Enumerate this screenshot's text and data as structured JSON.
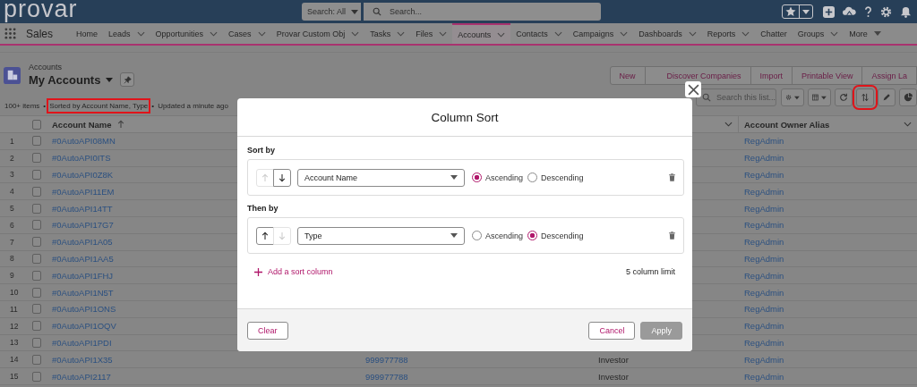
{
  "header": {
    "logo": "provar",
    "search_scope": "Search: All",
    "search": {
      "placeholder": "Search..."
    }
  },
  "nav": {
    "app": "Sales",
    "items": [
      {
        "label": "Home",
        "kind": "tab",
        "dropdown": false,
        "selected": false
      },
      {
        "label": "Leads",
        "kind": "tab",
        "dropdown": true,
        "selected": false
      },
      {
        "label": "Opportunities",
        "kind": "tab",
        "dropdown": true,
        "selected": false
      },
      {
        "label": "Cases",
        "kind": "tab",
        "dropdown": true,
        "selected": false
      },
      {
        "label": "Provar Custom Obj",
        "kind": "tab",
        "dropdown": true,
        "selected": false
      },
      {
        "label": "Tasks",
        "kind": "tab",
        "dropdown": true,
        "selected": false
      },
      {
        "label": "Files",
        "kind": "tab",
        "dropdown": true,
        "selected": false
      },
      {
        "label": "Accounts",
        "kind": "tab",
        "dropdown": true,
        "selected": true
      },
      {
        "label": "Contacts",
        "kind": "tab",
        "dropdown": true,
        "selected": false
      },
      {
        "label": "Campaigns",
        "kind": "tab",
        "dropdown": true,
        "selected": false
      },
      {
        "label": "Dashboards",
        "kind": "tab",
        "dropdown": true,
        "selected": false
      },
      {
        "label": "Reports",
        "kind": "tab",
        "dropdown": true,
        "selected": false
      },
      {
        "label": "Chatter",
        "kind": "tab",
        "dropdown": false,
        "selected": false
      },
      {
        "label": "Groups",
        "kind": "tab",
        "dropdown": true,
        "selected": false
      },
      {
        "label": "More",
        "kind": "more",
        "dropdown": true,
        "selected": false
      }
    ]
  },
  "list_header": {
    "object": "Accounts",
    "view": "My Accounts",
    "actions": [
      "New",
      "Discover Companies",
      "Import",
      "Printable View",
      "Assign La"
    ],
    "meta": [
      {
        "text": "100+ items",
        "highlighted": false
      },
      {
        "text": "•",
        "highlighted": false
      },
      {
        "text": "Sorted by Account Name, Type",
        "highlighted": true
      },
      {
        "text": "•",
        "highlighted": false
      },
      {
        "text": "Updated a minute ago",
        "highlighted": false
      }
    ],
    "search": {
      "placeholder": "Search this list..."
    },
    "tools": [
      {
        "kind": "settings",
        "dropdown": true,
        "highlighted": false
      },
      {
        "kind": "columns",
        "dropdown": true,
        "highlighted": false
      },
      {
        "kind": "refresh",
        "dropdown": false,
        "highlighted": false
      },
      {
        "kind": "sort",
        "dropdown": false,
        "highlighted": true
      },
      {
        "kind": "edit",
        "dropdown": false,
        "highlighted": false
      },
      {
        "kind": "chart",
        "dropdown": false,
        "highlighted": false
      }
    ]
  },
  "table": {
    "columns": [
      {
        "label": "Account Name",
        "sorted": true
      },
      {
        "label": "Account Owner Alias"
      }
    ],
    "all_checked": false,
    "rows": [
      {
        "number": "1",
        "checked": false,
        "name": "#0AutoAPI08MN",
        "owner": "RegAdmin"
      },
      {
        "number": "2",
        "checked": false,
        "name": "#0AutoAPI0ITS",
        "owner": "RegAdmin"
      },
      {
        "number": "3",
        "checked": false,
        "name": "#0AutoAPI0Z8K",
        "owner": "RegAdmin"
      },
      {
        "number": "4",
        "checked": false,
        "name": "#0AutoAPI11EM",
        "owner": "RegAdmin"
      },
      {
        "number": "5",
        "checked": false,
        "name": "#0AutoAPI14TT",
        "owner": "RegAdmin"
      },
      {
        "number": "6",
        "checked": false,
        "name": "#0AutoAPI17G7",
        "owner": "RegAdmin"
      },
      {
        "number": "7",
        "checked": false,
        "name": "#0AutoAPI1A05",
        "owner": "RegAdmin"
      },
      {
        "number": "8",
        "checked": false,
        "name": "#0AutoAPI1AA5",
        "owner": "RegAdmin"
      },
      {
        "number": "9",
        "checked": false,
        "name": "#0AutoAPI1FHJ",
        "owner": "RegAdmin"
      },
      {
        "number": "10",
        "checked": false,
        "name": "#0AutoAPI1N5T",
        "owner": "RegAdmin"
      },
      {
        "number": "11",
        "checked": false,
        "name": "#0AutoAPI1ONS",
        "owner": "RegAdmin"
      },
      {
        "number": "12",
        "checked": false,
        "name": "#0AutoAPI1OQV",
        "owner": "RegAdmin"
      },
      {
        "number": "13",
        "checked": false,
        "name": "#0AutoAPI1PDI",
        "owner": "RegAdmin"
      },
      {
        "number": "14",
        "checked": false,
        "name": "#0AutoAPI1X35",
        "column_3": "999977788",
        "column_4": "Investor",
        "owner": "RegAdmin"
      },
      {
        "number": "15",
        "checked": false,
        "name": "#0AutoAPI2117",
        "column_3": "999977788",
        "column_4": "Investor",
        "owner": "RegAdmin"
      }
    ]
  },
  "modal": {
    "title": "Column Sort",
    "sort_rows": [
      {
        "label": "Sort by",
        "field": "Account Name",
        "up_disabled": true,
        "down_disabled": false,
        "options": [
          {
            "label": "Ascending",
            "selected": true
          },
          {
            "label": "Descending",
            "selected": false
          }
        ]
      },
      {
        "label": "Then by",
        "field": "Type",
        "up_disabled": false,
        "down_disabled": true,
        "options": [
          {
            "label": "Ascending",
            "selected": false
          },
          {
            "label": "Descending",
            "selected": true
          }
        ]
      }
    ],
    "add_link": "Add a sort column",
    "limit": "5 column limit",
    "buttons": [
      {
        "label": "Clear",
        "kind": "neutral",
        "disabled": false
      },
      {
        "label": "Cancel",
        "kind": "neutral",
        "disabled": false
      },
      {
        "label": "Apply",
        "kind": "brand",
        "disabled": true
      }
    ]
  }
}
